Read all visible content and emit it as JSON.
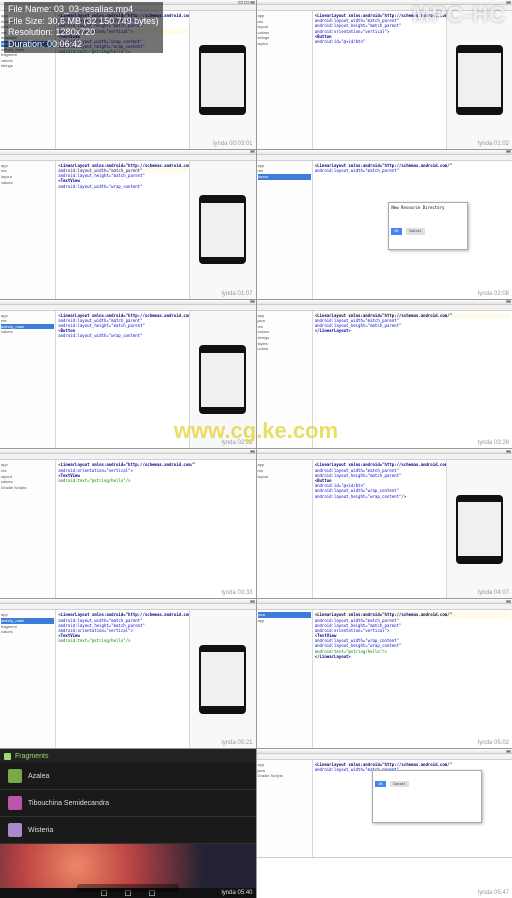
{
  "player": {
    "app_name": "MPC-HC",
    "file_name_label": "File Name:",
    "file_name": "03_03-resalias.mp4",
    "file_size_label": "File Size:",
    "file_size": "30,6 MB (32 150 749 bytes)",
    "resolution_label": "Resolution:",
    "resolution": "1280x720",
    "duration_label": "Duration:",
    "duration": "00:06:42"
  },
  "watermarks": {
    "center": "www.cg.ke.com",
    "lynda": "lynda"
  },
  "timestamps": [
    "00:03:01",
    "01:02",
    "01:07",
    "02:08",
    "02:25",
    "03:26",
    "03:33",
    "04:07",
    "05:21",
    "05:02",
    "05:40",
    "05:47"
  ],
  "tree_items": [
    "app",
    "manifests",
    "java",
    "res",
    "drawable",
    "layout",
    "activity_main",
    "fragment",
    "values",
    "strings",
    "styles",
    "colors",
    "dimens",
    "menu",
    "Gradle Scripts"
  ],
  "code_lines": [
    "<LinearLayout xmlns:android=\"http://schemas.android.com/\"",
    "  android:layout_width=\"match_parent\"",
    "  android:layout_height=\"match_parent\"",
    "  android:orientation=\"vertical\">",
    "  <TextView",
    "    android:layout_width=\"wrap_content\"",
    "    android:layout_height=\"wrap_content\"",
    "    android:text=\"@string/hello\"/>",
    "  <Button",
    "    android:id=\"@+id/btn\"",
    "    android:layout_width=\"wrap_content\"",
    "    android:layout_height=\"wrap_content\"/>",
    "</LinearLayout>"
  ],
  "dialog": {
    "title": "New Resource Directory",
    "ok": "OK",
    "cancel": "Cancel"
  },
  "android_app": {
    "header": "Fragments",
    "items": [
      "Azalea",
      "Tibouchina Semidecandra",
      "Wisteria"
    ]
  }
}
